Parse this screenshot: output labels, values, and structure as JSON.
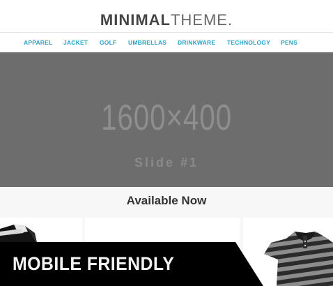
{
  "logo": {
    "bold": "MINIMAL",
    "light": "THEME."
  },
  "nav": {
    "items": [
      "APPAREL",
      "JACKET",
      "GOLF",
      "UMBRELLAS",
      "DRINKWARE",
      "TECHNOLOGY",
      "PENS"
    ]
  },
  "slider": {
    "size_text": "1600×400",
    "slide_label": "Slide #1"
  },
  "section": {
    "title": "Available Now"
  },
  "banner": {
    "text": "MOBILE FRIENDLY"
  },
  "colors": {
    "nav_link": "#2aa3c8",
    "slider_bg": "#6d6d6d",
    "banner_bg": "#000000"
  }
}
